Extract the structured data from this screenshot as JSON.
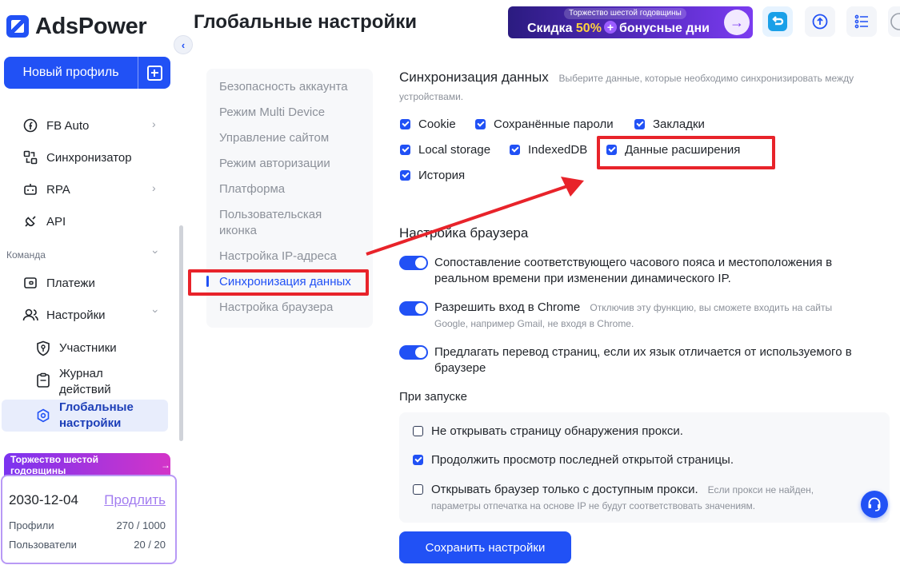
{
  "app": {
    "name": "AdsPower"
  },
  "header": {
    "title": "Глобальные настройки"
  },
  "banner": {
    "top": "Торжество шестой годовщины",
    "part1": "Скидка ",
    "percent": "50%",
    "plus": "+",
    "part2": "бонусные дни"
  },
  "sidebar": {
    "new_profile": "Новый профиль",
    "items": [
      {
        "label": "FB Auto"
      },
      {
        "label": "Синхронизатор"
      },
      {
        "label": "RPA"
      },
      {
        "label": "API"
      }
    ],
    "section_team": "Команда",
    "team_items": [
      {
        "label": "Платежи"
      },
      {
        "label": "Настройки"
      }
    ],
    "settings_sub": [
      {
        "label": "Участники"
      },
      {
        "label": "Журнал действий"
      },
      {
        "label": "Глобальные настройки"
      }
    ],
    "promo": "Торжество шестой годовщины",
    "plan": {
      "date": "2030-12-04",
      "renew": "Продлить",
      "profiles_label": "Профили",
      "profiles_value": "270 / 1000",
      "users_label": "Пользователи",
      "users_value": "20 / 20"
    }
  },
  "settings_menu": [
    "Безопасность аккаунта",
    "Режим Multi Device",
    "Управление сайтом",
    "Режим авторизации",
    "Платформа",
    "Пользовательская иконка",
    "Настройка IP-адреса",
    "Синхронизация данных",
    "Настройка браузера"
  ],
  "sync": {
    "title": "Синхронизация данных",
    "hint": "Выберите данные, которые необходимо синхронизировать между устройствами.",
    "options": [
      {
        "label": "Cookie",
        "checked": true
      },
      {
        "label": "Сохранённые пароли",
        "checked": true
      },
      {
        "label": "Закладки",
        "checked": true
      },
      {
        "label": "Local storage",
        "checked": true
      },
      {
        "label": "IndexedDB",
        "checked": true
      },
      {
        "label": "Данные расширения",
        "checked": true
      },
      {
        "label": "История",
        "checked": true
      }
    ]
  },
  "browser": {
    "title": "Настройка браузера",
    "toggles": [
      {
        "label": "Сопоставление соответствующего часового пояса и местоположения в реальном времени при изменении динамического IP.",
        "hint": "",
        "on": true
      },
      {
        "label": "Разрешить вход в Chrome",
        "hint": "Отключив эту функцию, вы сможете входить на сайты Google, например Gmail, не входя в Chrome.",
        "on": true
      },
      {
        "label": "Предлагать перевод страниц, если их язык отличается от используемого в браузере",
        "hint": "",
        "on": true
      }
    ]
  },
  "launch": {
    "title": "При запуске",
    "options": [
      {
        "label": "Не открывать страницу обнаружения прокси.",
        "hint": "",
        "checked": false
      },
      {
        "label": "Продолжить просмотр последней открытой страницы.",
        "hint": "",
        "checked": true
      },
      {
        "label": "Открывать браузер только с доступным прокси.",
        "hint": "Если прокси не найден, параметры отпечатка на основе IP не будут соответствовать значениям.",
        "checked": false
      }
    ]
  },
  "save_button": "Сохранить настройки",
  "colors": {
    "accent": "#2151f5",
    "highlight": "#e8232a"
  }
}
